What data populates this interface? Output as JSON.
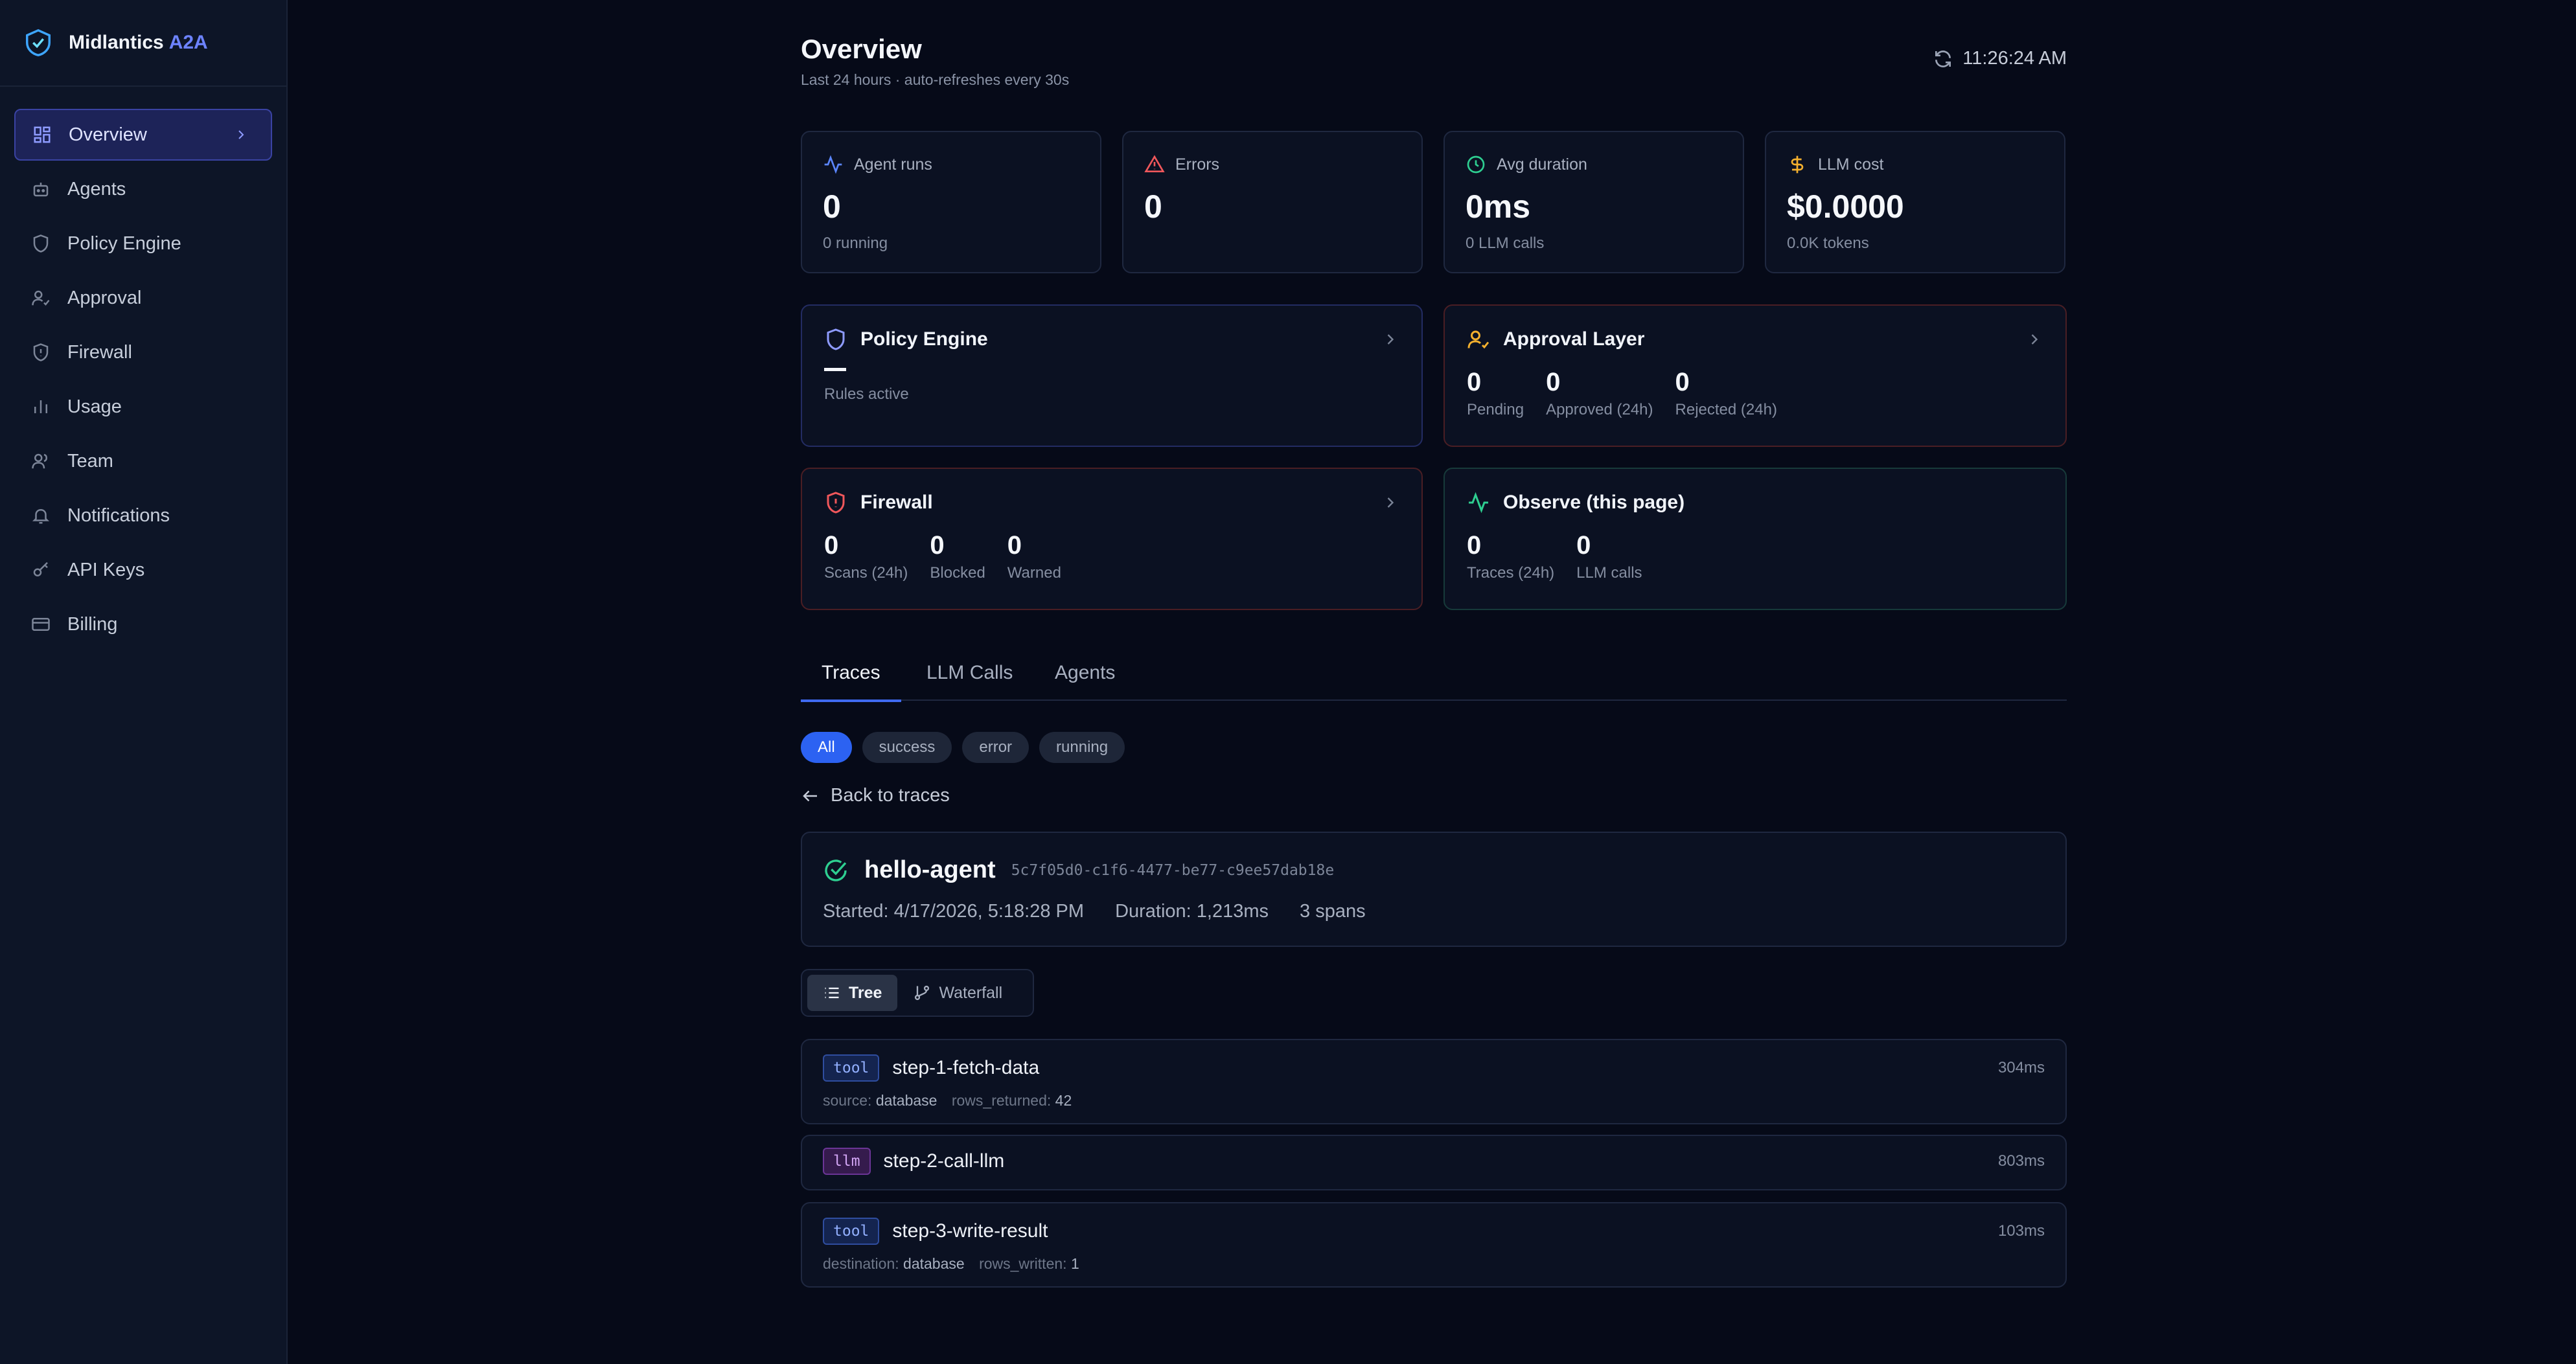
{
  "brand": {
    "name": "Midlantics",
    "accent": "A2A"
  },
  "sidebar": {
    "items": [
      {
        "label": "Overview",
        "icon": "dashboard-icon"
      },
      {
        "label": "Agents",
        "icon": "robot-icon"
      },
      {
        "label": "Policy Engine",
        "icon": "shield-icon"
      },
      {
        "label": "Approval",
        "icon": "user-check-icon"
      },
      {
        "label": "Firewall",
        "icon": "shield-alert-icon"
      },
      {
        "label": "Usage",
        "icon": "bar-chart-icon"
      },
      {
        "label": "Team",
        "icon": "users-icon"
      },
      {
        "label": "Notifications",
        "icon": "bell-icon"
      },
      {
        "label": "API Keys",
        "icon": "key-icon"
      },
      {
        "label": "Billing",
        "icon": "credit-card-icon"
      }
    ]
  },
  "header": {
    "title": "Overview",
    "subtitle": "Last 24 hours · auto-refreshes every 30s",
    "time": "11:26:24 AM"
  },
  "stats": {
    "runs": {
      "label": "Agent runs",
      "value": "0",
      "sub": "0 running"
    },
    "errors": {
      "label": "Errors",
      "value": "0",
      "sub": ""
    },
    "duration": {
      "label": "Avg duration",
      "value": "0ms",
      "sub": "0 LLM calls"
    },
    "cost": {
      "label": "LLM cost",
      "value": "$0.0000",
      "sub": "0.0K tokens"
    }
  },
  "modules": {
    "policy": {
      "title": "Policy Engine",
      "value": "—",
      "label": "Rules active"
    },
    "approval": {
      "title": "Approval Layer",
      "pending": "0",
      "pending_label": "Pending",
      "approved": "0",
      "approved_label": "Approved (24h)",
      "rejected": "0",
      "rejected_label": "Rejected (24h)"
    },
    "firewall": {
      "title": "Firewall",
      "scans": "0",
      "scans_label": "Scans (24h)",
      "blocked": "0",
      "blocked_label": "Blocked",
      "warned": "0",
      "warned_label": "Warned"
    },
    "observe": {
      "title": "Observe (this page)",
      "traces": "0",
      "traces_label": "Traces (24h)",
      "calls": "0",
      "calls_label": "LLM calls"
    }
  },
  "tabs": [
    "Traces",
    "LLM Calls",
    "Agents"
  ],
  "filters": [
    "All",
    "success",
    "error",
    "running"
  ],
  "back_label": "Back to traces",
  "trace": {
    "agent": "hello-agent",
    "id": "5c7f05d0-c1f6-4477-be77-c9ee57dab18e",
    "started": "Started: 4/17/2026, 5:18:28 PM",
    "duration": "Duration: 1,213ms",
    "spans": "3 spans"
  },
  "view_toggle": {
    "tree": "Tree",
    "waterfall": "Waterfall"
  },
  "span_list": [
    {
      "kind": "tool",
      "name": "step-1-fetch-data",
      "duration": "304ms",
      "meta": [
        {
          "key": "source:",
          "value": "database"
        },
        {
          "key": "rows_returned:",
          "value": "42"
        }
      ]
    },
    {
      "kind": "llm",
      "name": "step-2-call-llm",
      "duration": "803ms",
      "meta": []
    },
    {
      "kind": "tool",
      "name": "step-3-write-result",
      "duration": "103ms",
      "meta": [
        {
          "key": "destination:",
          "value": "database"
        },
        {
          "key": "rows_written:",
          "value": "1"
        }
      ]
    }
  ],
  "colors": {
    "accent": "#3f6af0",
    "success": "#2ecf91",
    "error": "#f0575b",
    "warning": "#f4b02e",
    "policy": "#8e9bff"
  }
}
